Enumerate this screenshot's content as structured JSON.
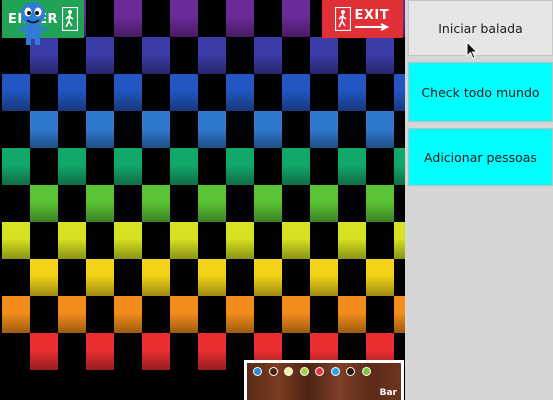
{
  "signs": {
    "enter": "ENTER",
    "exit": "EXIT"
  },
  "floor": {
    "colors": [
      "#6c2a98",
      "#3c3ca8",
      "#2255c0",
      "#2f7ad0",
      "#12a86a",
      "#5bc436",
      "#d6e222",
      "#f2d318",
      "#f28c1a",
      "#ea2e30"
    ]
  },
  "bar": {
    "label": "Bar",
    "drinks": [
      {
        "name": "blue-cocktail",
        "color": "#2a8ae0"
      },
      {
        "name": "brown-coffee",
        "color": "#4a2212"
      },
      {
        "name": "cream-drink",
        "color": "#f3f0a8"
      },
      {
        "name": "lime-drink",
        "color": "#9ed23e"
      },
      {
        "name": "red-cocktail",
        "color": "#e43a3a"
      },
      {
        "name": "cyan-cocktail",
        "color": "#26a6e8"
      },
      {
        "name": "dark-coffee",
        "color": "#2a160c"
      },
      {
        "name": "green-drink",
        "color": "#7cc43c"
      }
    ]
  },
  "buttons": {
    "start": "Iniciar balada",
    "check": "Check todo mundo",
    "add": "Adicionar pessoas"
  }
}
